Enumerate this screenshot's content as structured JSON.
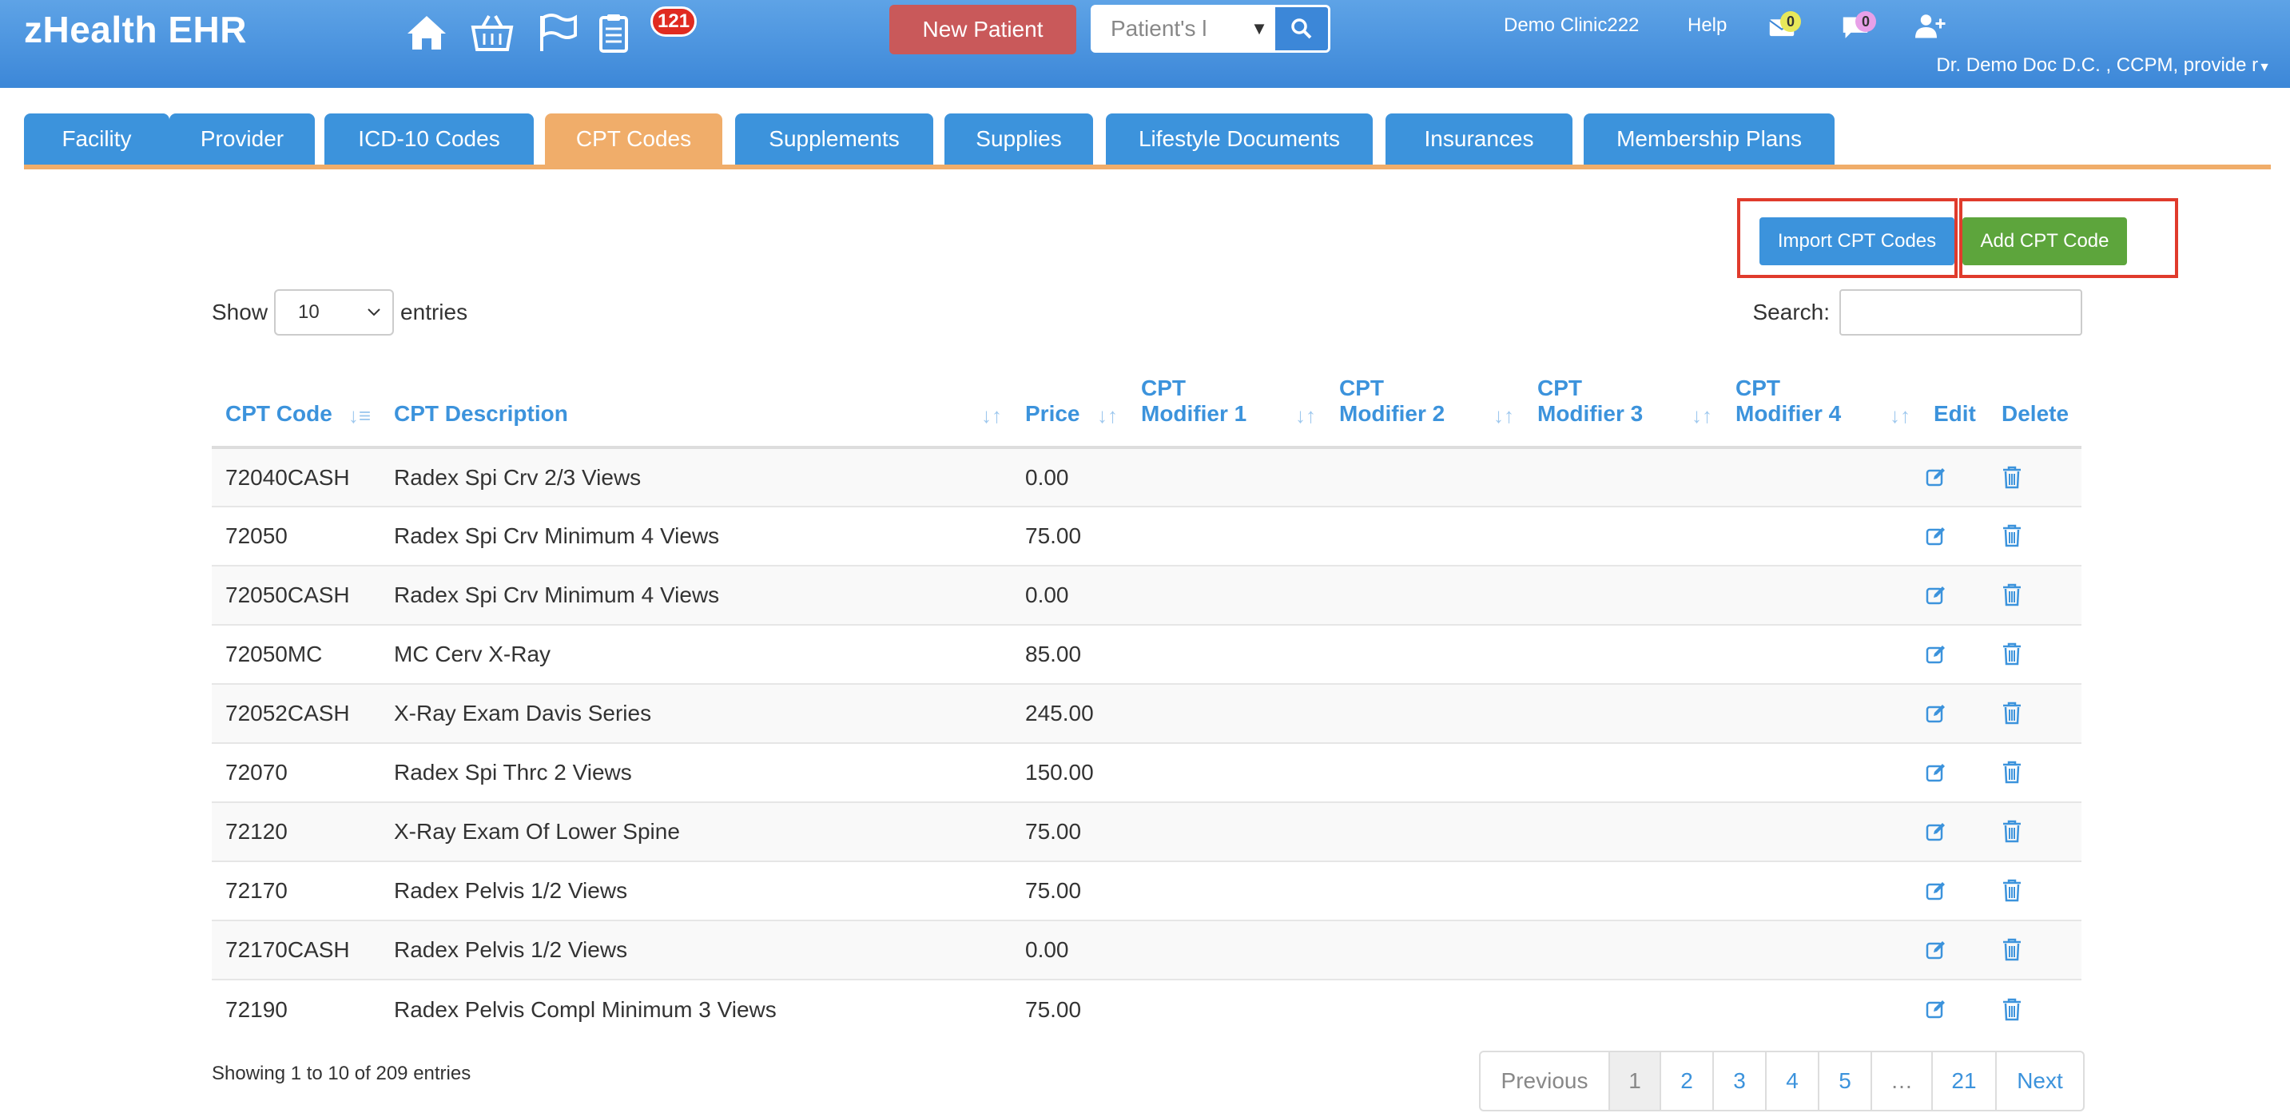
{
  "header": {
    "brand": "zHealth EHR",
    "notification_count": "121",
    "new_patient_label": "New Patient",
    "patient_search_placeholder": "Patient's l",
    "clinic": "Demo Clinic222",
    "help": "Help",
    "messages_count": "0",
    "chat_count": "0",
    "user": "Dr. Demo Doc D.C. , CCPM, provide r",
    "icons": [
      "home-icon",
      "basket-icon",
      "flag-icon",
      "clipboard-icon",
      "envelope-icon",
      "chat-icon",
      "add-user-icon"
    ]
  },
  "tabs": [
    {
      "label": "Facility"
    },
    {
      "label": "Provider"
    },
    {
      "label": "ICD-10 Codes"
    },
    {
      "label": "CPT Codes"
    },
    {
      "label": "Supplements"
    },
    {
      "label": "Supplies"
    },
    {
      "label": "Lifestyle Documents"
    },
    {
      "label": "Insurances"
    },
    {
      "label": "Membership Plans"
    }
  ],
  "active_tab": "CPT Codes",
  "actions": {
    "import_label": "Import CPT Codes",
    "add_label": "Add CPT Code"
  },
  "controls": {
    "show_label": "Show",
    "entries_value": "10",
    "entries_label": "entries",
    "search_label": "Search:"
  },
  "table": {
    "headers": {
      "code": "CPT Code",
      "description": "CPT Description",
      "price": "Price",
      "mod1_a": "CPT",
      "mod1_b": "Modifier 1",
      "mod2_a": "CPT",
      "mod2_b": "Modifier 2",
      "mod3_a": "CPT",
      "mod3_b": "Modifier 3",
      "mod4_a": "CPT",
      "mod4_b": "Modifier 4",
      "edit": "Edit",
      "delete": "Delete"
    },
    "rows": [
      {
        "code": "72040CASH",
        "description": "Radex Spi Crv 2/3 Views",
        "price": "0.00"
      },
      {
        "code": "72050",
        "description": "Radex Spi Crv Minimum 4 Views",
        "price": "75.00"
      },
      {
        "code": "72050CASH",
        "description": "Radex Spi Crv Minimum 4 Views",
        "price": "0.00"
      },
      {
        "code": "72050MC",
        "description": "MC Cerv X-Ray",
        "price": "85.00"
      },
      {
        "code": "72052CASH",
        "description": "X-Ray Exam Davis Series",
        "price": "245.00"
      },
      {
        "code": "72070",
        "description": "Radex Spi Thrc 2 Views",
        "price": "150.00"
      },
      {
        "code": "72120",
        "description": "X-Ray Exam Of Lower Spine",
        "price": "75.00"
      },
      {
        "code": "72170",
        "description": "Radex Pelvis 1/2 Views",
        "price": "75.00"
      },
      {
        "code": "72170CASH",
        "description": "Radex Pelvis 1/2 Views",
        "price": "0.00"
      },
      {
        "code": "72190",
        "description": "Radex Pelvis Compl Minimum 3 Views",
        "price": "75.00"
      }
    ]
  },
  "footer": {
    "info": "Showing 1 to 10 of 209 entries",
    "pages": [
      "Previous",
      "1",
      "2",
      "3",
      "4",
      "5",
      "…",
      "21",
      "Next"
    ],
    "current_page": "1"
  },
  "colors": {
    "header": "#3c87d8",
    "tab": "#3c93dc",
    "tab_active": "#f0ad6a",
    "import_button": "#3c93dc",
    "add_button": "#5da53c",
    "new_patient": "#c9595a",
    "highlight_box": "#e03b2c"
  }
}
